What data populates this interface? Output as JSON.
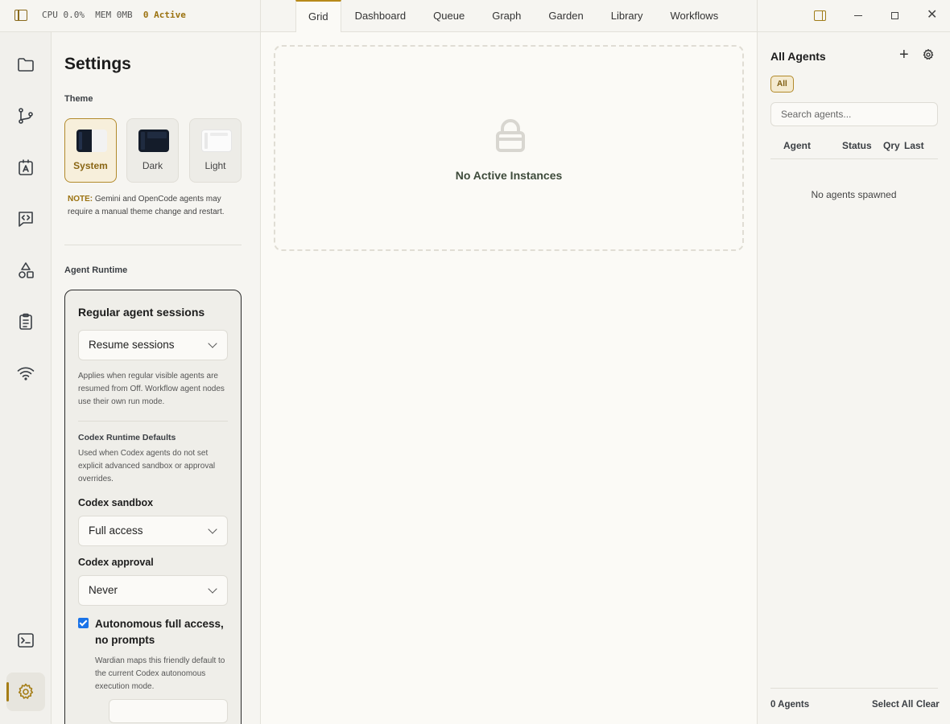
{
  "topbar": {
    "cpu": "CPU 0.0%",
    "mem": "MEM 0MB",
    "active": "0 Active",
    "tabs": [
      "Grid",
      "Dashboard",
      "Queue",
      "Graph",
      "Garden",
      "Library",
      "Workflows"
    ],
    "selected_tab": "Grid"
  },
  "rail": {
    "icons": [
      "folder-icon",
      "git-branch-icon",
      "agent-badge-icon",
      "code-chat-icon",
      "shapes-icon",
      "clipboard-icon",
      "wifi-icon",
      "terminal-icon",
      "gear-icon"
    ],
    "active": "gear-icon"
  },
  "settings": {
    "title": "Settings",
    "theme_label": "Theme",
    "themes": [
      "System",
      "Dark",
      "Light"
    ],
    "selected_theme": "System",
    "note_prefix": "NOTE:",
    "note_text": " Gemini and OpenCode agents may require a manual theme change and restart.",
    "runtime_label": "Agent Runtime",
    "runtime": {
      "title": "Regular agent sessions",
      "session_select": "Resume sessions",
      "session_help": "Applies when regular visible agents are resumed from Off. Workflow agent nodes use their own run mode.",
      "codex_heading": "Codex Runtime Defaults",
      "codex_help": "Used when Codex agents do not set explicit advanced sandbox or approval overrides.",
      "sandbox_label": "Codex sandbox",
      "sandbox_value": "Full access",
      "approval_label": "Codex approval",
      "approval_value": "Never",
      "autonomous_label": "Autonomous full access, no prompts",
      "autonomous_checked": true,
      "autonomous_help": "Wardian maps this friendly default to the current Codex autonomous execution mode."
    }
  },
  "main": {
    "empty_title": "No Active Instances"
  },
  "agents": {
    "title": "All Agents",
    "filter_chip": "All",
    "search_placeholder": "Search agents...",
    "columns": [
      "Agent",
      "Status",
      "Qry",
      "Last"
    ],
    "empty": "No agents spawned",
    "count": "0 Agents",
    "select_all": "Select All",
    "clear": "Clear"
  },
  "colors": {
    "accent": "#b78a1a",
    "accent_text": "#9b7210",
    "checkbox": "#1a73e8"
  }
}
